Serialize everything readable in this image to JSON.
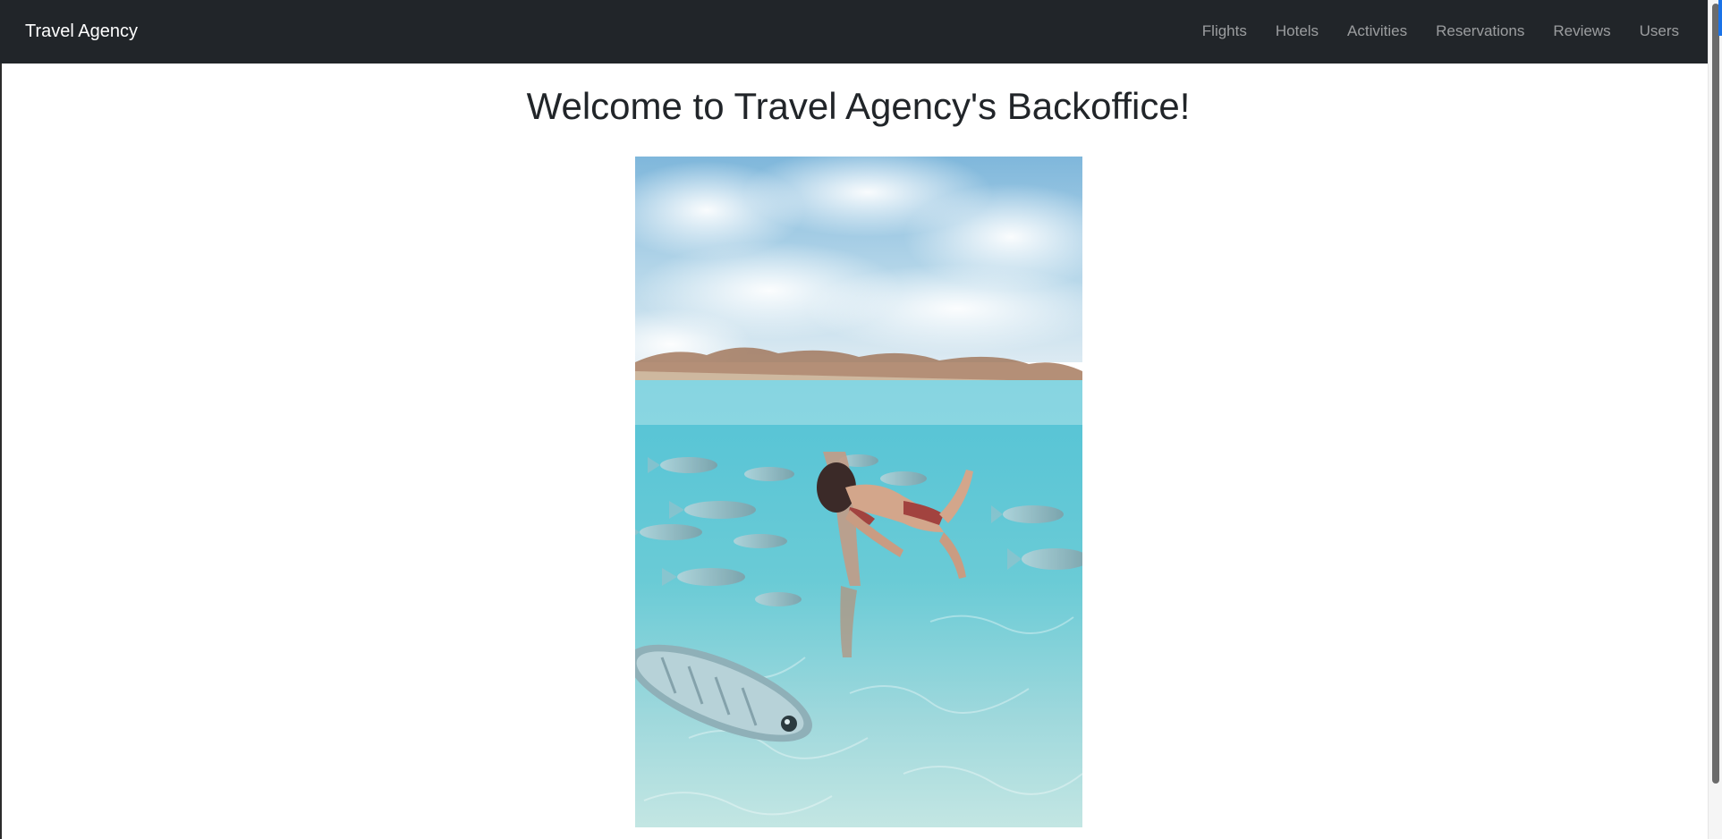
{
  "navbar": {
    "brand": "Travel Agency",
    "links": [
      {
        "label": "Flights"
      },
      {
        "label": "Hotels"
      },
      {
        "label": "Activities"
      },
      {
        "label": "Reservations"
      },
      {
        "label": "Reviews"
      },
      {
        "label": "Users"
      }
    ]
  },
  "main": {
    "title": "Welcome to Travel Agency's Backoffice!"
  },
  "colors": {
    "navbar_bg": "#212529",
    "brand_text": "#ffffff",
    "nav_link_text": "#9a9da0",
    "title_text": "#212529",
    "sky": "#8fc7e6",
    "water": "#5fc6d3",
    "sand": "#a9dde0"
  },
  "hero_image": {
    "icon": "underwater-swimmer-photo"
  }
}
